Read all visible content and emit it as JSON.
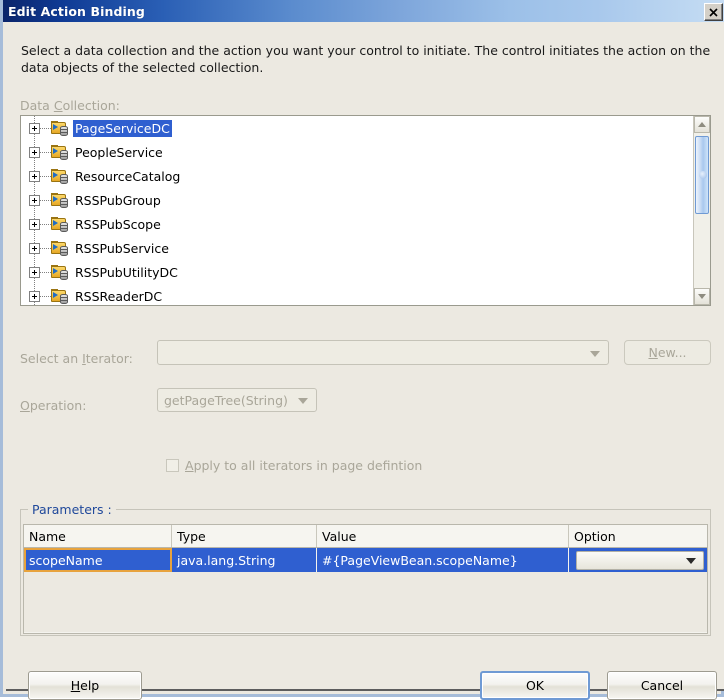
{
  "window": {
    "title": "Edit Action Binding",
    "close_label": "✕"
  },
  "description": "Select a data collection and the action you want your control to initiate. The control initiates the action on the data objects of the selected collection.",
  "data_collection": {
    "label": "Data Collection:",
    "items": [
      {
        "label": "PageServiceDC",
        "selected": true
      },
      {
        "label": "PeopleService",
        "selected": false
      },
      {
        "label": "ResourceCatalog",
        "selected": false
      },
      {
        "label": "RSSPubGroup",
        "selected": false
      },
      {
        "label": "RSSPubScope",
        "selected": false
      },
      {
        "label": "RSSPubService",
        "selected": false
      },
      {
        "label": "RSSPubUtilityDC",
        "selected": false
      },
      {
        "label": "RSSReaderDC",
        "selected": false
      }
    ]
  },
  "iterator": {
    "label": "Select an Iterator:",
    "value": "",
    "new_button": "New..."
  },
  "operation": {
    "label": "Operation:",
    "value": "getPageTree(String)"
  },
  "apply_all": {
    "label": "Apply to all iterators in page defintion",
    "checked": false
  },
  "parameters": {
    "group_title": "Parameters :",
    "columns": [
      "Name",
      "Type",
      "Value",
      "Option"
    ],
    "rows": [
      {
        "name": "scopeName",
        "type": "java.lang.String",
        "value": "#{PageViewBean.scopeName}",
        "option": ""
      }
    ]
  },
  "buttons": {
    "help": "Help",
    "ok": "OK",
    "cancel": "Cancel"
  },
  "colors": {
    "selection_blue": "#2f5fd0",
    "title_blue": "#0a246a",
    "focus_orange": "#e8a33d",
    "group_title": "#20499b",
    "disabled_text": "#a9a699"
  }
}
